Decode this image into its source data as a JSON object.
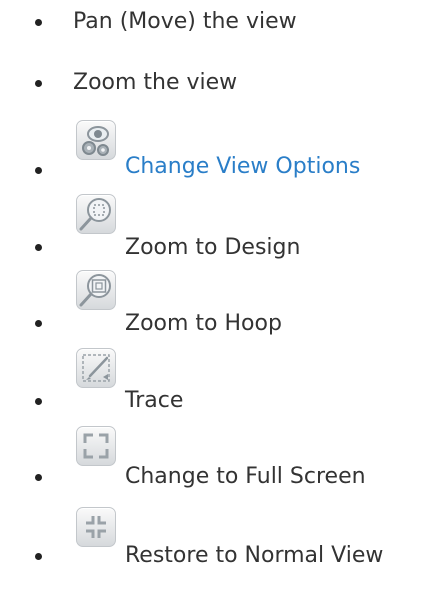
{
  "items": [
    {
      "label": "Pan (Move) the view",
      "icon": null,
      "link": false
    },
    {
      "label": "Zoom the view",
      "icon": null,
      "link": false
    },
    {
      "label": "Change View Options",
      "icon": "view-options-icon",
      "link": true
    },
    {
      "label": "Zoom to Design",
      "icon": "zoom-to-design-icon",
      "link": false
    },
    {
      "label": "Zoom to Hoop",
      "icon": "zoom-to-hoop-icon",
      "link": false
    },
    {
      "label": "Trace",
      "icon": "trace-icon",
      "link": false
    },
    {
      "label": "Change to Full Screen",
      "icon": "full-screen-icon",
      "link": false
    },
    {
      "label": "Restore to Normal View",
      "icon": "restore-normal-view-icon",
      "link": false
    }
  ],
  "colors": {
    "text": "#333333",
    "link": "#2a7ec8",
    "bullet": "#222222"
  }
}
